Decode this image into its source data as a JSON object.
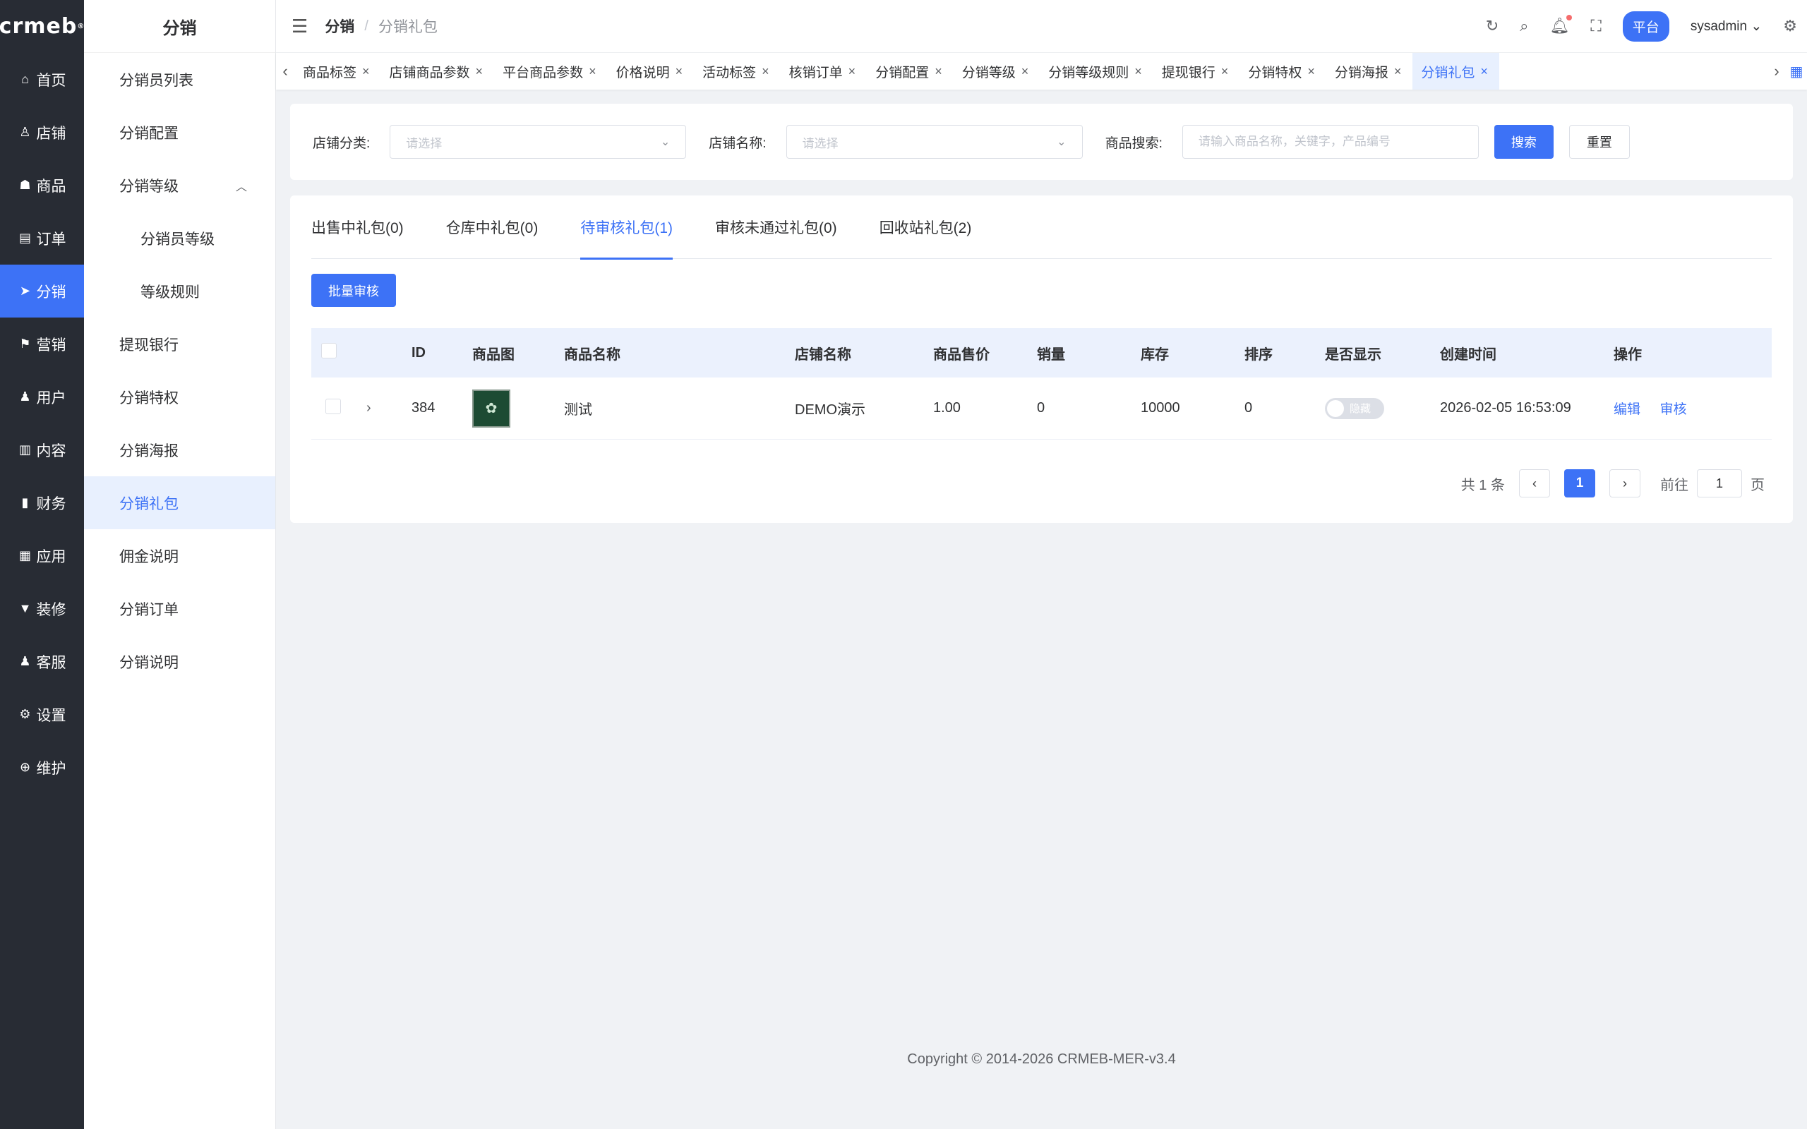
{
  "brand": {
    "logo": "crmeb"
  },
  "rail": {
    "items": [
      {
        "label": "首页",
        "icon": "home-icon",
        "glyph": "⌂"
      },
      {
        "label": "店铺",
        "icon": "store-icon",
        "glyph": "♙"
      },
      {
        "label": "商品",
        "icon": "bag-icon",
        "glyph": "☗"
      },
      {
        "label": "订单",
        "icon": "clipboard-icon",
        "glyph": "▤"
      },
      {
        "label": "分销",
        "icon": "send-icon",
        "glyph": "➤"
      },
      {
        "label": "营销",
        "icon": "flag-icon",
        "glyph": "⚑"
      },
      {
        "label": "用户",
        "icon": "user-icon",
        "glyph": "♟"
      },
      {
        "label": "内容",
        "icon": "book-icon",
        "glyph": "▥"
      },
      {
        "label": "财务",
        "icon": "bar-chart-icon",
        "glyph": "▮"
      },
      {
        "label": "应用",
        "icon": "grid-icon",
        "glyph": "▦"
      },
      {
        "label": "装修",
        "icon": "brush-icon",
        "glyph": "▼"
      },
      {
        "label": "客服",
        "icon": "person-icon",
        "glyph": "♟"
      },
      {
        "label": "设置",
        "icon": "gear-icon",
        "glyph": "⚙"
      },
      {
        "label": "维护",
        "icon": "plus-circle-icon",
        "glyph": "⊕"
      }
    ]
  },
  "submenu": {
    "title": "分销",
    "items": [
      {
        "label": "分销员列表"
      },
      {
        "label": "分销配置"
      },
      {
        "label": "分销等级"
      },
      {
        "label": "分销员等级"
      },
      {
        "label": "等级规则"
      },
      {
        "label": "提现银行"
      },
      {
        "label": "分销特权"
      },
      {
        "label": "分销海报"
      },
      {
        "label": "分销礼包"
      },
      {
        "label": "佣金说明"
      },
      {
        "label": "分销订单"
      },
      {
        "label": "分销说明"
      }
    ]
  },
  "header": {
    "breadcrumb_parent": "分销",
    "breadcrumb_sep": "/",
    "breadcrumb_current": "分销礼包",
    "platform_label": "平台",
    "username": "sysadmin"
  },
  "tags": [
    {
      "label": "商品标签"
    },
    {
      "label": "店铺商品参数"
    },
    {
      "label": "平台商品参数"
    },
    {
      "label": "价格说明"
    },
    {
      "label": "活动标签"
    },
    {
      "label": "核销订单"
    },
    {
      "label": "分销配置"
    },
    {
      "label": "分销等级"
    },
    {
      "label": "分销等级规则"
    },
    {
      "label": "提现银行"
    },
    {
      "label": "分销特权"
    },
    {
      "label": "分销海报"
    },
    {
      "label": "分销礼包"
    }
  ],
  "filter": {
    "shop_category_label": "店铺分类:",
    "shop_category_placeholder": "请选择",
    "shop_name_label": "店铺名称:",
    "shop_name_placeholder": "请选择",
    "search_label": "商品搜索:",
    "search_placeholder": "请输入商品名称，关键字，产品编号",
    "search_button": "搜索",
    "reset_button": "重置"
  },
  "tabs": [
    {
      "label": "出售中礼包(0)"
    },
    {
      "label": "仓库中礼包(0)"
    },
    {
      "label": "待审核礼包(1)"
    },
    {
      "label": "审核未通过礼包(0)"
    },
    {
      "label": "回收站礼包(2)"
    }
  ],
  "batch_button": "批量审核",
  "table": {
    "columns": {
      "id": "ID",
      "image": "商品图",
      "name": "商品名称",
      "shop": "店铺名称",
      "price": "商品售价",
      "sales": "销量",
      "stock": "库存",
      "sort": "排序",
      "show": "是否显示",
      "created": "创建时间",
      "ops": "操作"
    },
    "rows": [
      {
        "id": "384",
        "name": "测试",
        "shop": "DEMO演示",
        "price": "1.00",
        "sales": "0",
        "stock": "10000",
        "sort": "0",
        "show_label": "隐藏",
        "created": "2026-02-05 16:53:09",
        "edit": "编辑",
        "audit": "审核"
      }
    ]
  },
  "pager": {
    "total": "共 1 条",
    "current": "1",
    "goto_prefix": "前往",
    "goto_value": "1",
    "goto_suffix": "页"
  },
  "footer": "Copyright © 2014-2026 CRMEB-MER-v3.4",
  "colors": {
    "accent": "#3d72f6",
    "rail_bg": "#282c34"
  }
}
